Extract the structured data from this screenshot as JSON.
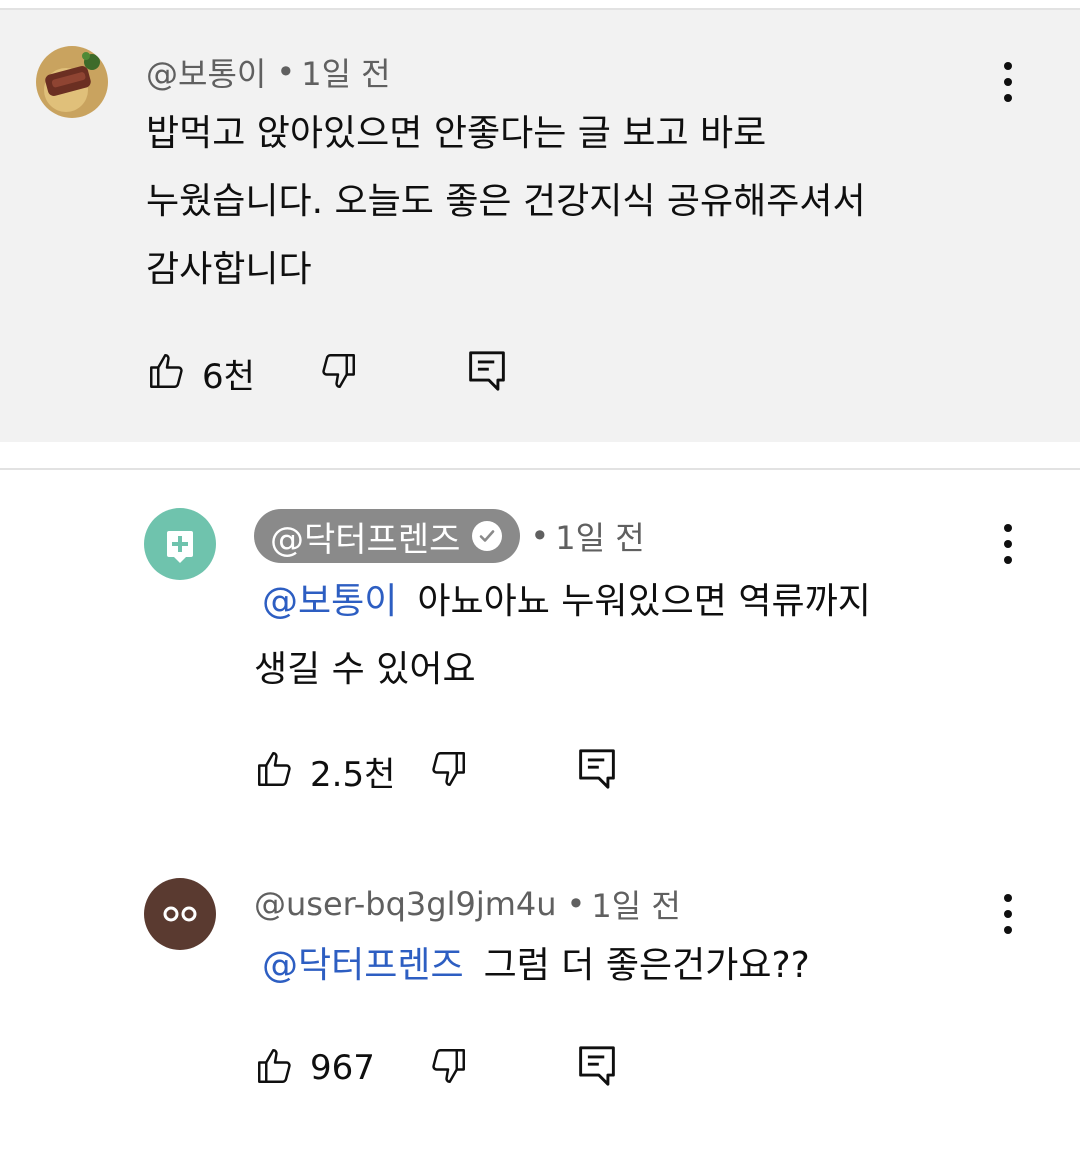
{
  "comments": [
    {
      "author": "@보통이",
      "time": "1일 전",
      "lines": [
        "밥먹고 앉아있으면 안좋다는 글 보고 바로",
        "누웠습니다. 오늘도 좋은 건강지식 공유해주셔서",
        "감사합니다"
      ],
      "likes": "6천",
      "avatar_icon": "steak-photo-avatar"
    },
    {
      "author": "@닥터프렌즈",
      "verified": true,
      "time": "1일 전",
      "mention": "@보통이",
      "lines": [
        "아뇨아뇨 누워있으면 역류까지",
        "생길 수 있어요"
      ],
      "likes": "2.5천",
      "avatar_color": "#6fc3ad",
      "avatar_icon": "medical-plus-icon"
    },
    {
      "author": "@user-bq3gl9jm4u",
      "time": "1일 전",
      "mention": "@닥터프렌즈",
      "lines": [
        "그럼 더 좋은건가요??"
      ],
      "likes": "967",
      "avatar_color": "#5a3a30",
      "avatar_icon": "eyes-face-icon"
    }
  ],
  "colors": {
    "mention": "#2d5ec2",
    "highlight_bg": "#f2f2f2",
    "meta_text": "#606060"
  }
}
